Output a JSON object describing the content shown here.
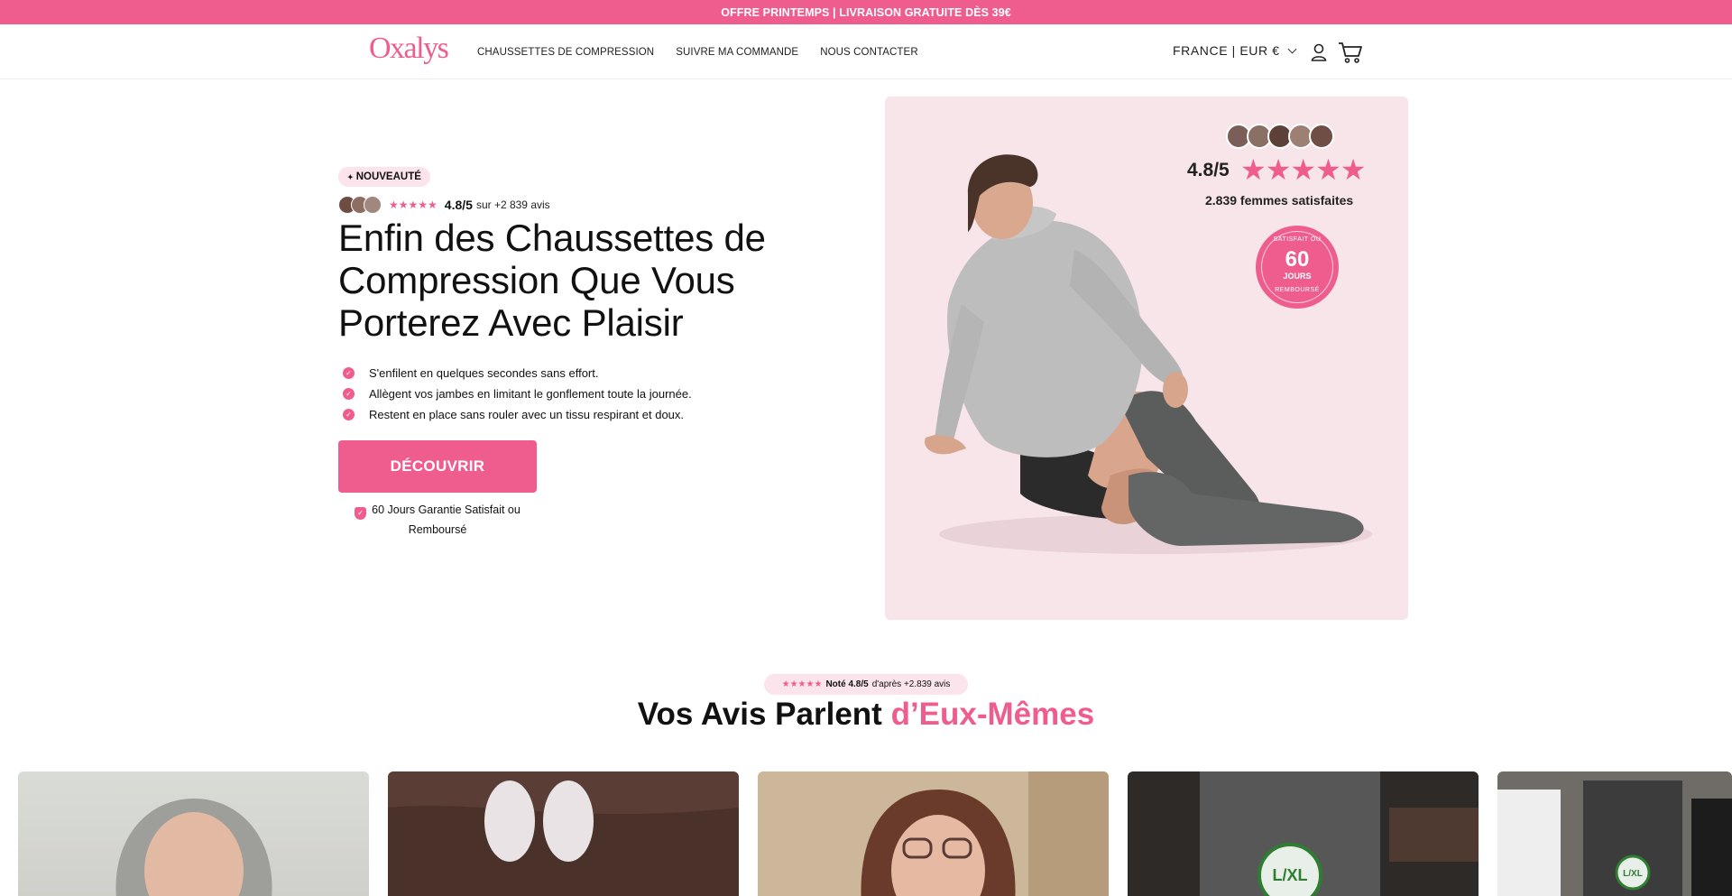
{
  "announcement": {
    "text": "OFFRE PRINTEMPS | LIVRAISON GRATUITE DÈS 39€"
  },
  "header": {
    "logo": "Oxalys",
    "nav": [
      {
        "label": "CHAUSSETTES DE COMPRESSION"
      },
      {
        "label": "SUIVRE MA COMMANDE"
      },
      {
        "label": "NOUS CONTACTER"
      }
    ],
    "region": "FRANCE | EUR €",
    "account_icon": "user-icon",
    "cart_icon": "cart-icon"
  },
  "hero": {
    "badge": "NOUVEAUTÉ",
    "badge_icon": "sparkle-icon",
    "rating": {
      "stars": "★★★★★",
      "score": "4.8/5",
      "count": "sur +2 839 avis"
    },
    "title": "Enfin des Chaussettes de Compression Que Vous Porterez Avec Plaisir",
    "bullets": [
      {
        "text": "S'enfilent en quelques secondes sans effort."
      },
      {
        "text": "Allègent vos jambes en limitant le gonflement toute la journée."
      },
      {
        "text": "Restent en place sans rouler avec un tissu respirant et doux."
      }
    ],
    "cta": "DÉCOUVRIR",
    "guarantee": "60 Jours Garantie Satisfait ou Remboursé"
  },
  "panel": {
    "score": "4.8/5",
    "stars": "★★★★★",
    "satisfied": "2.839 femmes satisfaites",
    "seal": {
      "top": "SATISFAIT OU",
      "number": "60",
      "unit": "JOURS",
      "bottom": "REMBOURSÉ"
    }
  },
  "reviews": {
    "pill_stars": "★★★★★",
    "pill_score": "Noté 4.8/5",
    "pill_count": "d'après +2.839 avis",
    "title_plain": "Vos Avis Parlent ",
    "title_accent": "d’Eux-Mêmes"
  },
  "colors": {
    "brand": "#ef5d8f",
    "pill_bg": "#fbe4ec",
    "panel_bg": "#f7e5ea"
  }
}
